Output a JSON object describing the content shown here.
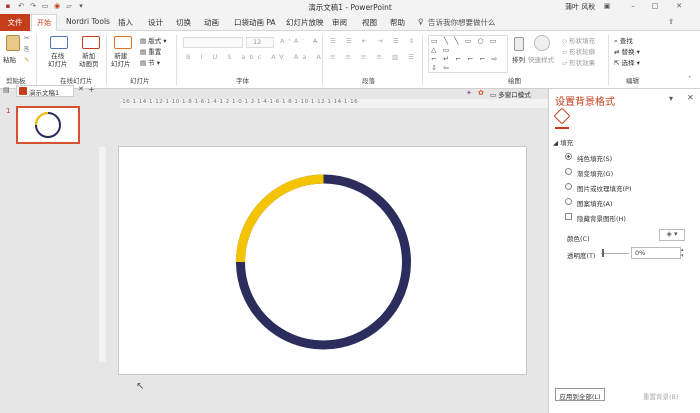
{
  "window": {
    "title": "演示文稿1 - PowerPoint",
    "user": "蒲叶 风秋"
  },
  "tabs": [
    "文件",
    "开始",
    "Nordri Tools",
    "插入",
    "设计",
    "切换",
    "动画",
    "口袋动画 PA",
    "幻灯片放映",
    "审阅",
    "视图",
    "帮助"
  ],
  "tell_me": "告诉我你想要做什么",
  "ribbon": {
    "paste": "粘贴",
    "online_slides": "在线\n幻灯片",
    "new_slide_play": "新加\n动画页",
    "new_slide": "新建\n幻灯片",
    "layout": "版式",
    "reset": "重置",
    "section": "节",
    "font_size": "12",
    "arrange": "排列",
    "quick_styles": "快速样式",
    "shape_fill": "形状填充",
    "shape_outline": "形状轮廓",
    "shape_effects": "形状效果",
    "find": "查找",
    "replace": "替换",
    "select": "选择",
    "groups": [
      "剪贴板",
      "在线幻灯片",
      "幻灯片",
      "字体",
      "段落",
      "绘图",
      "编辑"
    ]
  },
  "doc_tab": "演示文稿1",
  "slide_num": "1",
  "multi_window": "多窗口模式",
  "ruler_h": "·16·1·14·1·12·1·10·1·8·1·6·1·4·1·2·1·0·1·2·1·4·1·6·1·8·1·10·1·12·1·14·1·16·",
  "pane": {
    "title": "设置背景格式",
    "section": "填充",
    "options": [
      "纯色填充(S)",
      "渐变填充(G)",
      "图片或纹理填充(P)",
      "图案填充(A)"
    ],
    "selected": 0,
    "hide_bg": "隐藏背景图形(H)",
    "color_label": "颜色(C)",
    "transparency_label": "透明度(T)",
    "transparency_value": "0%",
    "apply_all": "应用到全部(L)",
    "reset_bg": "重置背景(B)"
  },
  "colors": {
    "accent": "#c43e1c",
    "ring": "#2b2d5c",
    "arc": "#f5c400"
  },
  "chart_data": {
    "type": "pie",
    "categories": [
      "yellow arc",
      "navy ring"
    ],
    "values": [
      25,
      75
    ]
  }
}
